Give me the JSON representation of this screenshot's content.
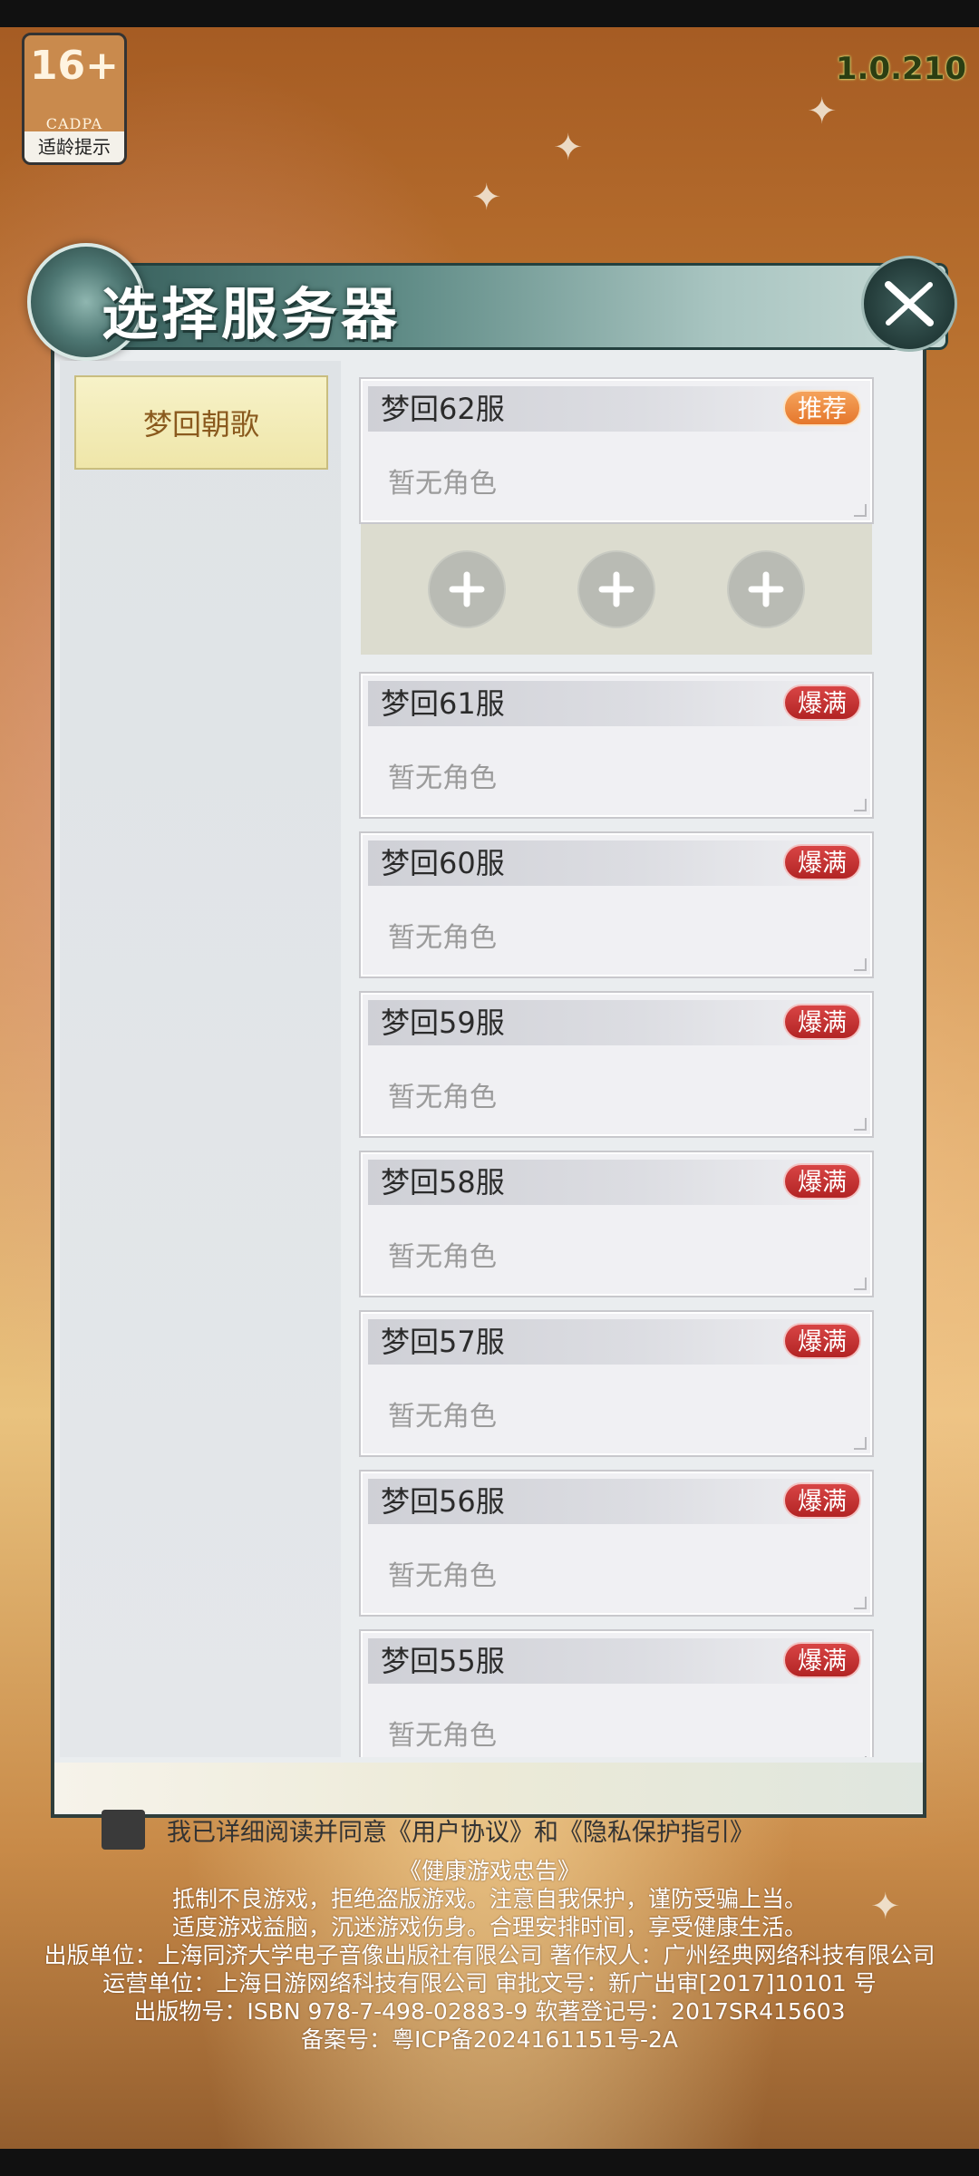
{
  "version": "1.0.210",
  "age_rating": {
    "label": "16+",
    "org": "CADPA",
    "tip": "适龄提示"
  },
  "dialog": {
    "title": "选择服务器",
    "zone_tab": "梦回朝歌",
    "empty_role_text": "暂无角色",
    "servers": [
      {
        "name": "梦回62服",
        "status": "推荐",
        "status_type": "recommended",
        "role": "暂无角色"
      },
      {
        "name": "梦回61服",
        "status": "爆满",
        "status_type": "full",
        "role": "暂无角色"
      },
      {
        "name": "梦回60服",
        "status": "爆满",
        "status_type": "full",
        "role": "暂无角色"
      },
      {
        "name": "梦回59服",
        "status": "爆满",
        "status_type": "full",
        "role": "暂无角色"
      },
      {
        "name": "梦回58服",
        "status": "爆满",
        "status_type": "full",
        "role": "暂无角色"
      },
      {
        "name": "梦回57服",
        "status": "爆满",
        "status_type": "full",
        "role": "暂无角色"
      },
      {
        "name": "梦回56服",
        "status": "爆满",
        "status_type": "full",
        "role": "暂无角色"
      },
      {
        "name": "梦回55服",
        "status": "爆满",
        "status_type": "full",
        "role": "暂无角色"
      }
    ]
  },
  "agreement_text": "我已详细阅读并同意《用户协议》和《隐私保护指引》",
  "notice": [
    "《健康游戏忠告》",
    "抵制不良游戏，拒绝盗版游戏。注意自我保护，谨防受骗上当。",
    "适度游戏益脑，沉迷游戏伤身。合理安排时间，享受健康生活。",
    "出版单位：上海同济大学电子音像出版社有限公司 著作权人：广州经典网络科技有限公司",
    "运营单位：上海日游网络科技有限公司 审批文号：新广出审[2017]10101 号",
    "出版物号：ISBN 978-7-498-02883-9 软著登记号：2017SR415603",
    "备案号：粤ICP备2024161151号-2A"
  ],
  "colors": {
    "recommended": "#e5772c",
    "full": "#b22424",
    "zone_tab_text": "#8a5a1e",
    "version_text": "#2b3e12"
  }
}
